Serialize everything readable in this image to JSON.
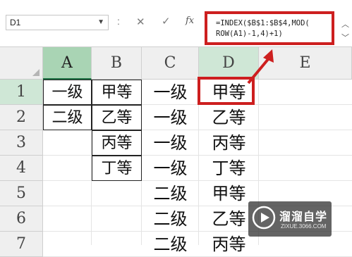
{
  "namebox": {
    "value": "D1",
    "dropdown_icon": "chevron-down"
  },
  "formula_bar": {
    "separator": ":",
    "cancel": "✕",
    "enter": "✓",
    "fx": "fx",
    "formula_line1": "=INDEX($B$1:$B$4,MOD(",
    "formula_line2": "ROW(A1)-1,4)+1)",
    "highlight_color": "#cd1f1f"
  },
  "columns": [
    "A",
    "B",
    "C",
    "D",
    "E"
  ],
  "rows": [
    "1",
    "2",
    "3",
    "4",
    "5",
    "6",
    "7"
  ],
  "cells": {
    "A": [
      "一级",
      "二级",
      "",
      "",
      "",
      "",
      ""
    ],
    "B": [
      "甲等",
      "乙等",
      "丙等",
      "丁等",
      "",
      "",
      ""
    ],
    "C": [
      "一级",
      "一级",
      "一级",
      "一级",
      "二级",
      "二级",
      "二级"
    ],
    "D": [
      "甲等",
      "乙等",
      "丙等",
      "丁等",
      "甲等",
      "乙等",
      "丙等"
    ],
    "E": [
      "",
      "",
      "",
      "",
      "",
      "",
      ""
    ]
  },
  "selected_cell": "D1",
  "watermark": {
    "title": "溜溜自学",
    "subtitle": "ZIXUE.3066.COM"
  }
}
